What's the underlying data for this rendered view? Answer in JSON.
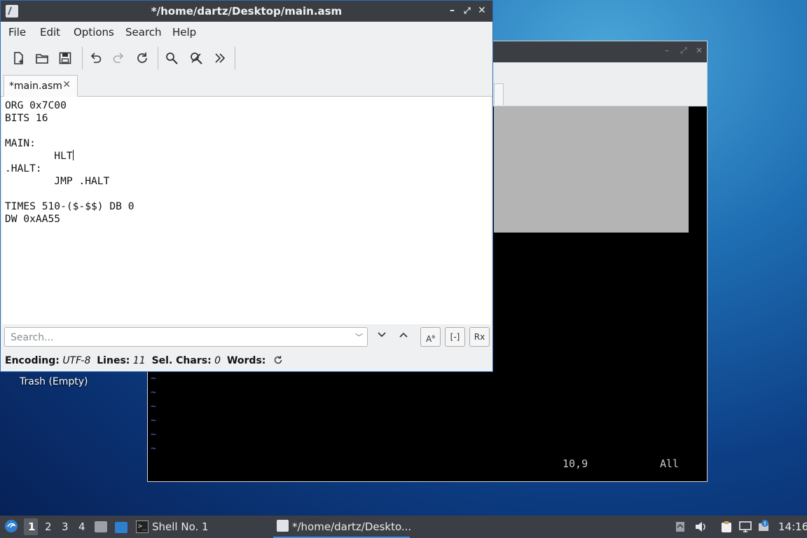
{
  "editor": {
    "title": "*/home/dartz/Desktop/main.asm",
    "menu": [
      "File",
      "Edit",
      "Options",
      "Search",
      "Help"
    ],
    "tab_label": "*main.asm",
    "code_lines": [
      "ORG 0x7C00",
      "BITS 16",
      "",
      "MAIN:",
      "        HLT",
      ".HALT:",
      "        JMP .HALT",
      "",
      "TIMES 510-($-$$) DB 0",
      "DW 0xAA55"
    ],
    "search_placeholder": "Search...",
    "option_buttons": [
      "A",
      "[-]",
      "Rx"
    ],
    "status": {
      "encoding_label": "Encoding:",
      "encoding_value": "UTF-8",
      "lines_label": "Lines:",
      "lines_value": "11",
      "sel_label": "Sel. Chars:",
      "sel_value": "0",
      "words_label": "Words:"
    }
  },
  "terminal": {
    "tilde": "~",
    "cursor_pos": "10,9",
    "view": "All"
  },
  "desktop": {
    "trash_label": "Trash (Empty)"
  },
  "taskbar": {
    "workspaces": [
      "1",
      "2",
      "3",
      "4"
    ],
    "tasks": [
      {
        "label": "Shell No. 1"
      },
      {
        "label": "*/home/dartz/Deskto..."
      }
    ],
    "clock": "14:16"
  }
}
